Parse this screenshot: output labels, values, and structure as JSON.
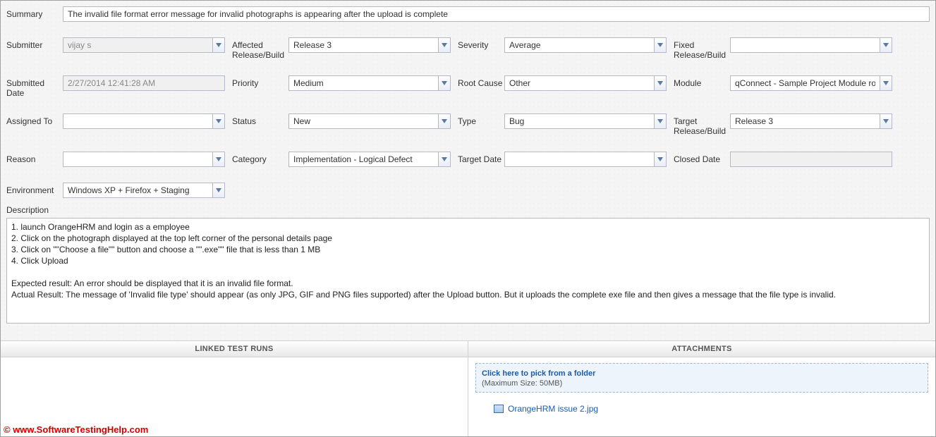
{
  "labels": {
    "summary": "Summary",
    "submitter": "Submitter",
    "affected": "Affected Release/Build",
    "severity": "Severity",
    "fixed": "Fixed Release/Build",
    "submittedDate": "Submitted Date",
    "priority": "Priority",
    "rootCause": "Root Cause",
    "module": "Module",
    "assignedTo": "Assigned To",
    "status": "Status",
    "type": "Type",
    "target": "Target Release/Build",
    "reason": "Reason",
    "category": "Category",
    "targetDate": "Target Date",
    "closedDate": "Closed Date",
    "environment": "Environment",
    "description": "Description"
  },
  "values": {
    "summary": "The invalid file format error message for invalid photographs is appearing after the upload is complete",
    "submitter": "vijay s",
    "affected": "Release 3",
    "severity": "Average",
    "fixed": "",
    "submittedDate": "2/27/2014 12:41:28 AM",
    "priority": "Medium",
    "rootCause": "Other",
    "module": "qConnect - Sample Project Module root",
    "assignedTo": "",
    "status": "New",
    "type": "Bug",
    "target": "Release 3",
    "reason": "",
    "category": "Implementation - Logical Defect",
    "targetDate": "",
    "closedDate": "",
    "environment": "Windows XP + Firefox + Staging",
    "description": "1. launch OrangeHRM and login as a employee\n2. Click on the photograph displayed at the top left corner of the personal details page\n3. Click on \"\"Choose a file\"\" button and choose a \"\".exe\"\" file that is less than 1 MB\n4. Click Upload\n\nExpected result: An error should be displayed that it is an invalid file format.\nActual Result: The message of 'Invalid file type' should appear (as only JPG, GIF and PNG files supported) after the Upload button. But it uploads the complete exe file and then gives a message that the file type is invalid."
  },
  "panels": {
    "linked": "LINKED TEST RUNS",
    "attachments": "ATTACHMENTS",
    "uploadLink": "Click here to pick from a folder",
    "uploadHint": "(Maximum Size: 50MB)",
    "attachmentName": "OrangeHRM issue 2.jpg"
  },
  "watermark": "© www.SoftwareTestingHelp.com"
}
